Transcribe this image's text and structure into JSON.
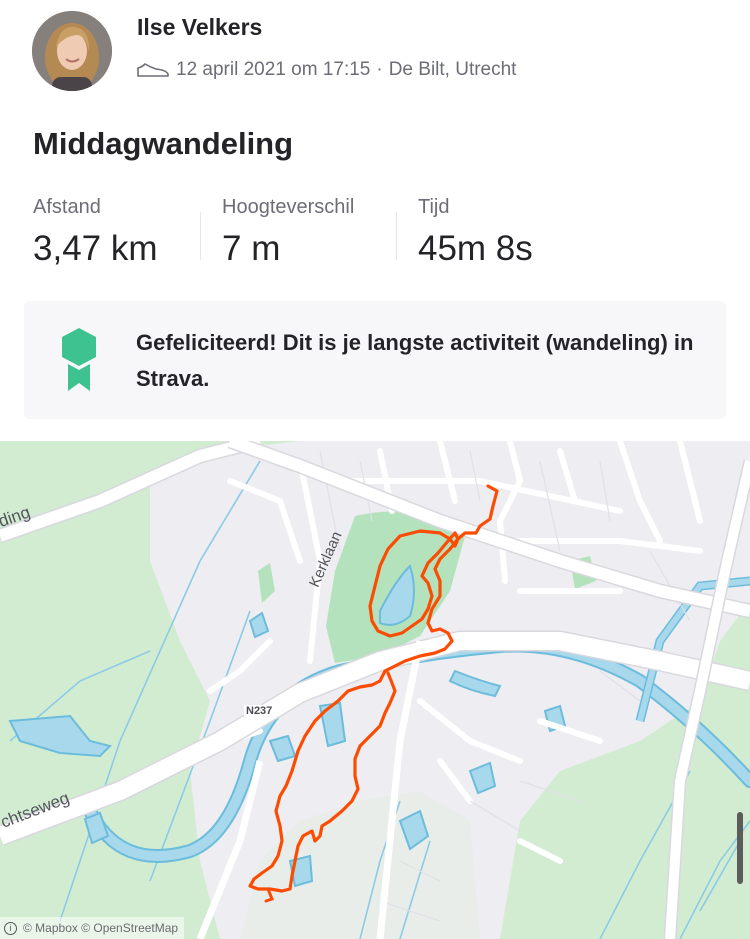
{
  "activity": {
    "athlete_name": "Ilse Velkers",
    "date_time": "12 april 2021 om 17:15",
    "separator": "·",
    "location": "De Bilt, Utrecht",
    "sport_icon": "shoe-icon",
    "title": "Middagwandeling"
  },
  "stats": [
    {
      "label": "Afstand",
      "value": "3,47 km"
    },
    {
      "label": "Hoogteverschil",
      "value": "7 m"
    },
    {
      "label": "Tijd",
      "value": "45m 8s"
    }
  ],
  "achievement": {
    "icon": "medal-badge-icon",
    "text": "Gefeliciteerd! Dit is je langste activiteit (wandeling) in Strava.",
    "badge_color": "#3ec28f"
  },
  "map": {
    "labels": {
      "top_left_street": "ding",
      "kerklaan": "Kerklaan",
      "road_shield": "N237",
      "bottom_left_street": "chtseweg"
    },
    "attribution": "© Mapbox © OpenStreetMap",
    "colors": {
      "route": "#fc4c02",
      "water": "#a8d8ec",
      "water_edge": "#6cbcdc",
      "green": "#d2ecd2",
      "park": "#b4e2bc",
      "urban": "#ededf2",
      "road": "#ffffff"
    }
  }
}
